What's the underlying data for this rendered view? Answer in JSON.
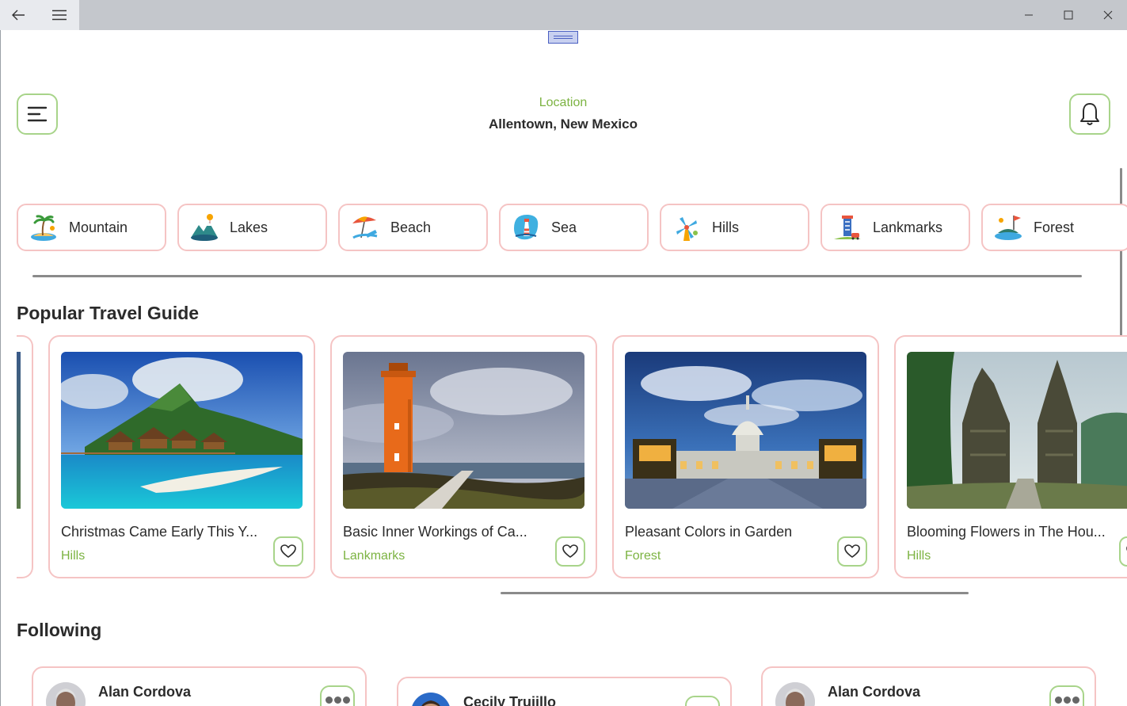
{
  "header": {
    "location_label": "Location",
    "location_value": "Allentown, New Mexico"
  },
  "categories": [
    {
      "label": "Mountain",
      "icon": "island-icon"
    },
    {
      "label": "Lakes",
      "icon": "lake-icon"
    },
    {
      "label": "Beach",
      "icon": "beach-icon"
    },
    {
      "label": "Sea",
      "icon": "lighthouse-icon"
    },
    {
      "label": "Hills",
      "icon": "windmill-icon"
    },
    {
      "label": "Lankmarks",
      "icon": "landmark-icon"
    },
    {
      "label": "Forest",
      "icon": "flag-island-icon"
    }
  ],
  "sections": {
    "popular_title": "Popular Travel Guide",
    "following_title": "Following"
  },
  "guides": [
    {
      "title": "Christmas Came Early This Y...",
      "category": "Hills",
      "image": "tropical-island-photo"
    },
    {
      "title": "Basic Inner Workings of Ca...",
      "category": "Lankmarks",
      "image": "lighthouse-photo"
    },
    {
      "title": "Pleasant Colors in Garden",
      "category": "Forest",
      "image": "capitol-building-photo"
    },
    {
      "title": "Blooming Flowers in The Hou...",
      "category": "Hills",
      "image": "temple-gate-photo"
    }
  ],
  "following": [
    {
      "name": "Alan Cordova"
    },
    {
      "name": "Cecily Trujillo"
    },
    {
      "name": "Alan Cordova"
    }
  ],
  "colors": {
    "accent_green": "#7cb342",
    "card_border_pink": "#f5c4c4",
    "icon_border_green": "#a8d48a"
  }
}
